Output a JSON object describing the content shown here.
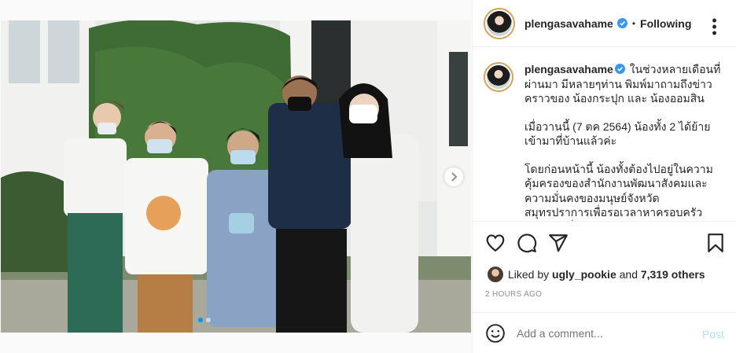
{
  "post": {
    "username": "plengasavahame",
    "follow_status": "Following",
    "caption_username": "plengasavahame",
    "caption_line1": "ในช่วงหลายเดือนที่ผ่านมา มีหลายๆท่าน พิมพ์มาถามถึงข่าวคราวของ น้องกระปุก และ น้องออมสิน",
    "caption_line2": "เมื่อวานนี้ (7 ตค 2564) น้องทั้ง 2 ได้ย้ายเข้ามาที่บ้านแล้วค่ะ",
    "caption_line3": "โดยก่อนหน้านี้ น้องทั้งต้องไปอยู่ในความคุ้มครองของสำนักงานพัฒนาสังคมและความมั่นคงของมนุษย์จังหวัดสมุทรปราการเพื่อรอเวลาหาครอบครัวอุปถัมภ์ (ซึ่งครอบครัวเรา",
    "liked_by_prefix": "Liked by",
    "liked_by_user": "ugly_pookie",
    "liked_by_and": "and",
    "liked_by_others": "7,319 others",
    "timestamp": "2 HOURS AGO",
    "comment_placeholder": "Add a comment...",
    "post_label": "Post"
  },
  "icons": {
    "verified": "verified-badge-icon",
    "more": "more-options-icon",
    "like": "heart-icon",
    "comment": "comment-icon",
    "share": "paper-plane-icon",
    "save": "bookmark-icon",
    "emoji": "emoji-icon",
    "next": "chevron-right-icon"
  },
  "colors": {
    "verified_blue": "#3897f0",
    "post_button": "#b2dffc",
    "muted_text": "#8e8e8e",
    "carousel_active_dot": "#0095f6"
  }
}
